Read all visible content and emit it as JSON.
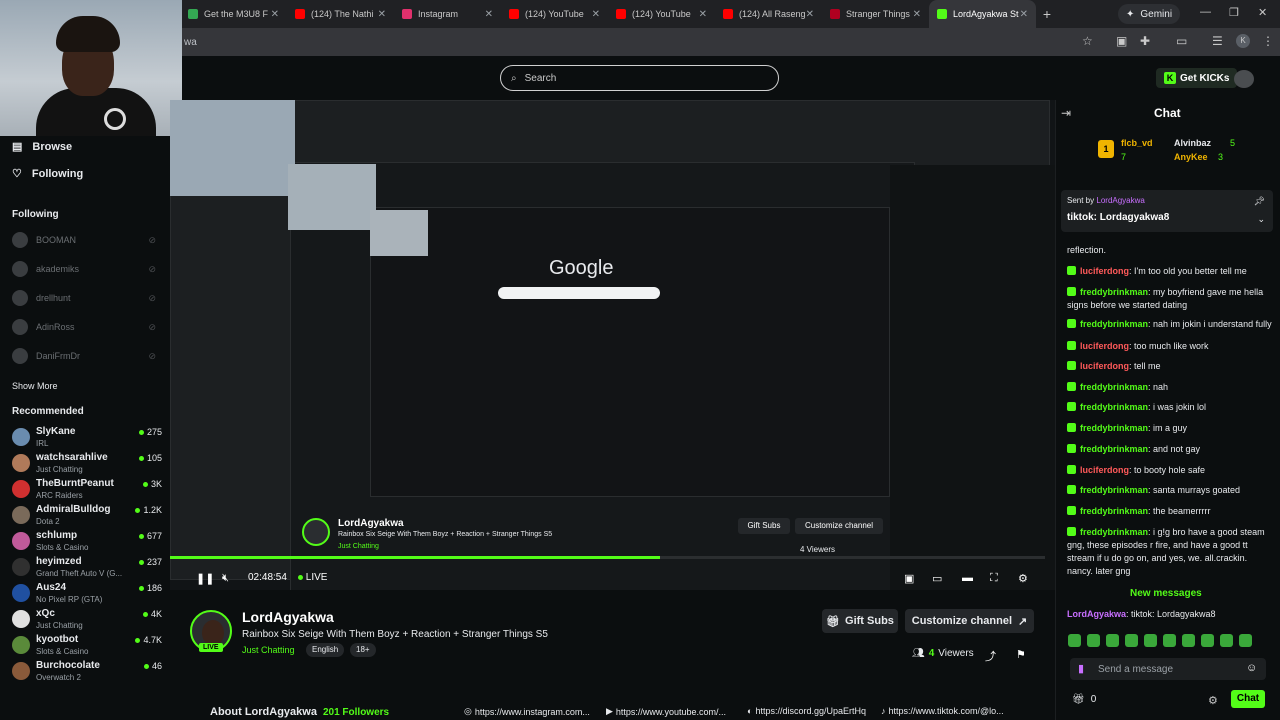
{
  "browser": {
    "tabs": [
      {
        "label": "Get the M3U8 F",
        "color": "#34a853"
      },
      {
        "label": "(124) The Nathi",
        "color": "#ff0000"
      },
      {
        "label": "Instagram",
        "color": "#e1306c"
      },
      {
        "label": "(124) YouTube",
        "color": "#ff0000"
      },
      {
        "label": "(124) YouTube",
        "color": "#ff0000"
      },
      {
        "label": "(124) All Raseng",
        "color": "#ff0000"
      },
      {
        "label": "Stranger Things",
        "color": "#b00020"
      },
      {
        "label": "LordAgyakwa St",
        "color": "#53fc18"
      }
    ],
    "gemini_label": "Gemini",
    "url": "wa"
  },
  "header": {
    "search_placeholder": "Search",
    "get_kicks_label": "Get KICKs"
  },
  "sidebar": {
    "browse": "Browse",
    "following_nav": "Following",
    "following_heading": "Following",
    "following": [
      "BOOMAN",
      "akademiks",
      "drellhunt",
      "AdinRoss",
      "DaniFrmDr"
    ],
    "show_more": "Show More",
    "recommended_heading": "Recommended",
    "recommended": [
      {
        "name": "SlyKane",
        "category": "IRL",
        "viewers": "275",
        "color": "#6a8caf"
      },
      {
        "name": "watchsarahlive",
        "category": "Just Chatting",
        "viewers": "105",
        "color": "#b07a5a"
      },
      {
        "name": "TheBurntPeanut",
        "category": "ARC Raiders",
        "viewers": "3K",
        "color": "#d03030"
      },
      {
        "name": "AdmiralBulldog",
        "category": "Dota 2",
        "viewers": "1.2K",
        "color": "#7a6a5a"
      },
      {
        "name": "schlump",
        "category": "Slots & Casino",
        "viewers": "677",
        "color": "#c05a9a"
      },
      {
        "name": "heyimzed",
        "category": "Grand Theft Auto V (G...",
        "viewers": "237",
        "color": "#303030"
      },
      {
        "name": "Aus24",
        "category": "No Pixel RP (GTA)",
        "viewers": "186",
        "color": "#2050a0"
      },
      {
        "name": "xQc",
        "category": "Just Chatting",
        "viewers": "4K",
        "color": "#e0e0e0"
      },
      {
        "name": "kyootbot",
        "category": "Slots & Casino",
        "viewers": "4.7K",
        "color": "#5a8a3a"
      },
      {
        "name": "Burchocolate",
        "category": "Overwatch 2",
        "viewers": "46",
        "color": "#8a5a3a"
      }
    ]
  },
  "player": {
    "google_text": "Google",
    "progress_fraction": 0.56,
    "time": "02:48:54",
    "live_label": "LIVE",
    "inner_channel": "LordAgyakwa",
    "inner_title": "Rainbox Six Seige With Them Boyz + Reaction + Stranger Things S5",
    "inner_category": "Just Chatting",
    "inner_tags": [
      "English",
      "18+"
    ],
    "inner_gift": "Gift Subs",
    "inner_customize": "Customize channel",
    "inner_viewers": "4 Viewers"
  },
  "stream": {
    "channel": "LordAgyakwa",
    "title": "Rainbox Six Seige With Them Boyz + Reaction + Stranger Things S5",
    "category": "Just Chatting",
    "tags": [
      "English",
      "18+"
    ],
    "live_badge": "LIVE",
    "gift_subs": "Gift Subs",
    "customize": "Customize channel",
    "viewer_count": "4",
    "viewer_label": "Viewers",
    "about": "About LordAgyakwa",
    "followers": "201 Followers",
    "links": [
      "https://www.instagram.com...",
      "https://www.youtube.com/...",
      "https://discord.gg/UpaErtHq",
      "https://www.tiktok.com/@lo..."
    ]
  },
  "chat": {
    "title": "Chat",
    "gifters": [
      {
        "name": "flcb_vd",
        "rank": "1",
        "count": "7"
      },
      {
        "name": "Alvinbaz",
        "count": "5"
      },
      {
        "name": "AnyKee",
        "count": "3"
      }
    ],
    "pinned_by_prefix": "Sent by",
    "pinned_by": "LordAgyakwa",
    "pinned_message": "tiktok: Lordagyakwa8",
    "messages": [
      {
        "user": "",
        "text": "reflection.",
        "cls": "g"
      },
      {
        "user": "luciferdong",
        "text": ": I'm too old you better tell me",
        "cls": "r"
      },
      {
        "user": "freddybrinkman",
        "text": ": my boyfriend gave me hella signs before we started dating",
        "cls": "g"
      },
      {
        "user": "freddybrinkman",
        "text": ": nah im jokin i understand fully",
        "cls": "g"
      },
      {
        "user": "luciferdong",
        "text": ": too much like work",
        "cls": "r"
      },
      {
        "user": "luciferdong",
        "text": ": tell me",
        "cls": "r"
      },
      {
        "user": "freddybrinkman",
        "text": ": nah",
        "cls": "g"
      },
      {
        "user": "freddybrinkman",
        "text": ": i was jokin lol",
        "cls": "g"
      },
      {
        "user": "freddybrinkman",
        "text": ": im a guy",
        "cls": "g"
      },
      {
        "user": "freddybrinkman",
        "text": ": and not gay",
        "cls": "g"
      },
      {
        "user": "luciferdong",
        "text": ": to booty hole safe",
        "cls": "r"
      },
      {
        "user": "freddybrinkman",
        "text": ": santa murrays goated",
        "cls": "g"
      },
      {
        "user": "freddybrinkman",
        "text": ": the beamerrrrr",
        "cls": "g"
      },
      {
        "user": "freddybrinkman",
        "text": ": i g!g bro have a good steam gng, these episodes r fire, and have a good tt stream if u do go on, and yes, we. all.crackin. nancy. later gng",
        "cls": "g"
      }
    ],
    "new_messages": "New messages",
    "last_message_user": "LordAgyakwa",
    "last_message_text": ": tiktok: Lordagyakwa8",
    "send_placeholder": "Send a message",
    "points": "0",
    "chat_button": "Chat"
  }
}
